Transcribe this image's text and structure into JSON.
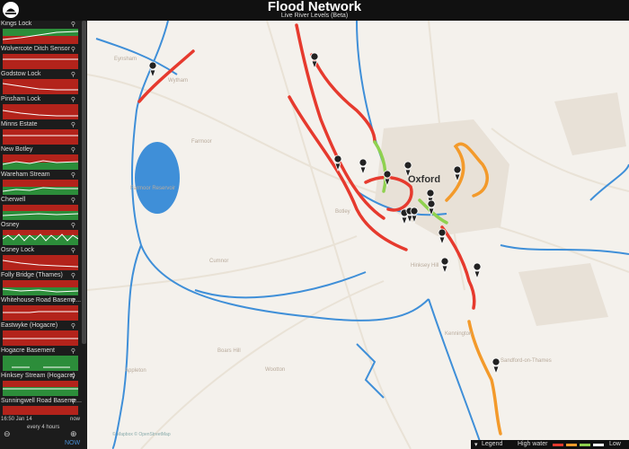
{
  "app": {
    "title": "Flood Network",
    "subtitle": "Live River Levels (Beta)"
  },
  "sidebar": {
    "stations": [
      {
        "name": "Kings Lock",
        "status": "mixed"
      },
      {
        "name": "Wolvercote Ditch Sensor",
        "status": "high"
      },
      {
        "name": "Godstow Lock",
        "status": "high"
      },
      {
        "name": "Pinsham Lock",
        "status": "high"
      },
      {
        "name": "Minns Estate",
        "status": "high"
      },
      {
        "name": "New Botley",
        "status": "mixed"
      },
      {
        "name": "Wareham Stream",
        "status": "mixed"
      },
      {
        "name": "Cherwell",
        "status": "mixed"
      },
      {
        "name": "Osney",
        "status": "mixed"
      },
      {
        "name": "Osney Lock",
        "status": "high"
      },
      {
        "name": "Folly Bridge (Thames)",
        "status": "mixed"
      },
      {
        "name": "Whitehouse Road Baseme...",
        "status": "high"
      },
      {
        "name": "Eastwyke (Hogacre)",
        "status": "high"
      },
      {
        "name": "Hogacre Basement",
        "status": "low"
      },
      {
        "name": "Hinksey Stream (Hogacre)",
        "status": "mixed"
      },
      {
        "name": "Sunningwell Road Baseme...",
        "status": "high"
      }
    ],
    "footer": {
      "timestamp": "16:50 Jan 14",
      "interval": "every 4 hours",
      "next": "now",
      "now": "NOW"
    }
  },
  "map": {
    "city": "Oxford",
    "places": [
      "Wytham",
      "Farmoor",
      "Farmoor Reservoir",
      "Botley",
      "Cumnor",
      "Appleton",
      "Wootton",
      "Boars Hill",
      "Kennington",
      "Sandford-on-Thames",
      "Eynsham",
      "Hinksey Hill"
    ],
    "attribution": "© Mapbox © OpenStreetMap"
  },
  "legend": {
    "title": "Legend",
    "high": "High water",
    "low": "Low"
  },
  "colors": {
    "high": "#e63a2e",
    "medium": "#f39a2b",
    "normal": "#8fd14f",
    "low": "#ffffff",
    "river": "#3f8fd8"
  }
}
